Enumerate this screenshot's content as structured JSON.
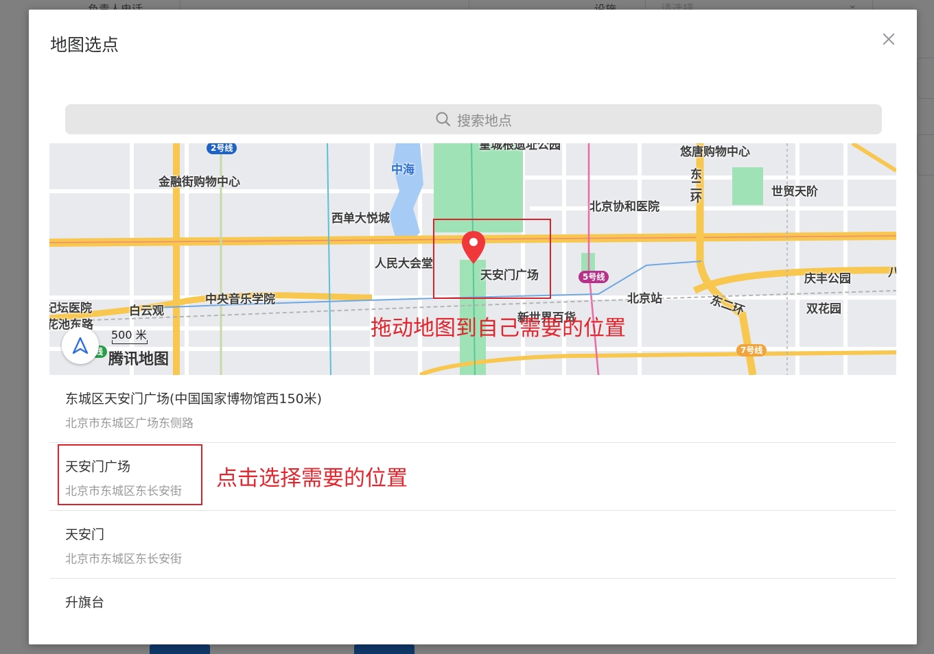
{
  "background": {
    "left_label": "负责人电话",
    "right_label": "设施",
    "select_placeholder": "请选择",
    "select_chevron": "⌄"
  },
  "modal": {
    "title": "地图选点",
    "close_icon": "close-icon"
  },
  "search": {
    "placeholder": "搜索地点",
    "icon": "search-icon"
  },
  "map": {
    "pois": [
      {
        "label": "金融街购物中心"
      },
      {
        "label": "西单大悦城"
      },
      {
        "label": "中海"
      },
      {
        "label": "人民大会堂"
      },
      {
        "label": "天安门广场"
      },
      {
        "label": "中央音乐学院"
      },
      {
        "label": "白云观"
      },
      {
        "label": "北京协和医院"
      },
      {
        "label": "北京站"
      },
      {
        "label": "世贸天阶"
      },
      {
        "label": "庆丰公园"
      },
      {
        "label": "双花园"
      },
      {
        "label": "新世界百货"
      },
      {
        "label": "悠唐购物中心"
      },
      {
        "label": "皇城根遗址公园"
      },
      {
        "label": "纪坛医院"
      },
      {
        "label": "花池东路"
      },
      {
        "label": "东二环"
      },
      {
        "label": "东二环"
      },
      {
        "label": "八"
      }
    ],
    "metro_lines": [
      {
        "label": "2号线",
        "color": "#1e62c5"
      },
      {
        "label": "5号线",
        "color": "#b7318a"
      },
      {
        "label": "7号线",
        "color": "#f1a43c"
      },
      {
        "label": "线",
        "color": "#2a9d49"
      }
    ],
    "scale_label": "500 米",
    "logo": "腾讯地图",
    "pin_icon": "location-pin-icon",
    "locate_icon": "locate-arrow-icon",
    "annotation": "拖动地图到自己需要的位置"
  },
  "results": [
    {
      "name": "东城区天安门广场(中国国家博物馆西150米)",
      "address": "北京市东城区广场东侧路"
    },
    {
      "name": "天安门广场",
      "address": "北京市东城区东长安街"
    },
    {
      "name": "天安门",
      "address": "北京市东城区东长安街"
    },
    {
      "name": "升旗台",
      "address": ""
    }
  ],
  "result_annotation": "点击选择需要的位置",
  "colors": {
    "annotation_red": "#e3262d",
    "road_yellow": "#f7c74f",
    "park_green": "#9fe2b6",
    "water_blue": "#a6cbf5"
  }
}
